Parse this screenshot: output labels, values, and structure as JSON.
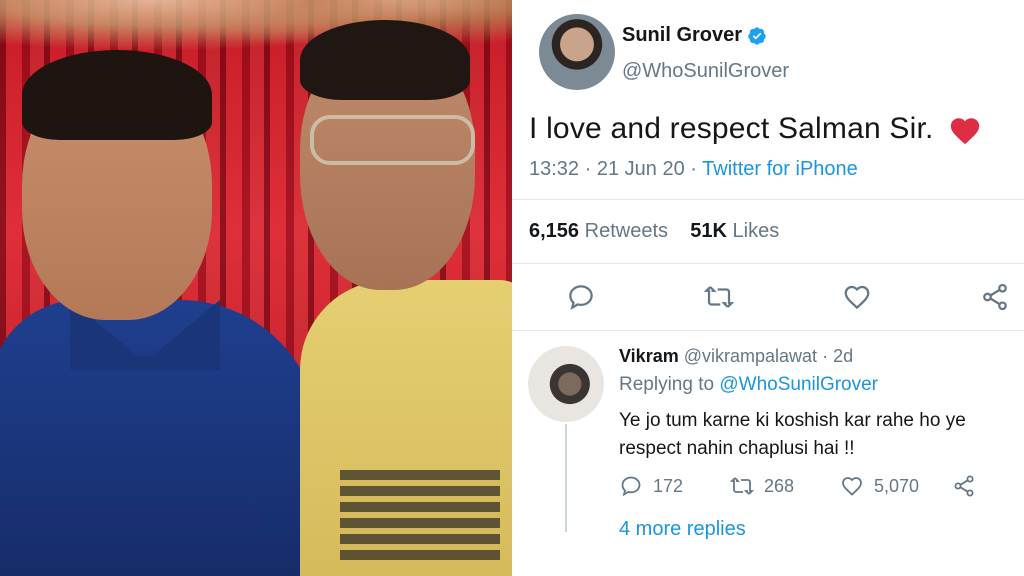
{
  "tweet": {
    "author_name": "Sunil Grover",
    "author_handle": "@WhoSunilGrover",
    "text": "I love and respect Salman Sir.",
    "time": "13:32",
    "date": "21 Jun 20",
    "source": "Twitter for iPhone",
    "retweets_count": "6,156",
    "retweets_label": "Retweets",
    "likes_count": "51K",
    "likes_label": "Likes"
  },
  "reply": {
    "author_name": "Vikram",
    "author_handle": "@vikrampalawat",
    "age": "2d",
    "replying_prefix": "Replying to",
    "replying_to": "@WhoSunilGrover",
    "text": "Ye jo tum karne ki koshish kar rahe ho ye respect nahin chaplusi hai !!",
    "replies_count": "172",
    "retweets_count": "268",
    "likes_count": "5,070",
    "more_replies": "4 more replies"
  },
  "colors": {
    "accent": "#1b95e0",
    "muted": "#657786",
    "text": "#14171a",
    "heart": "#e0245e"
  }
}
